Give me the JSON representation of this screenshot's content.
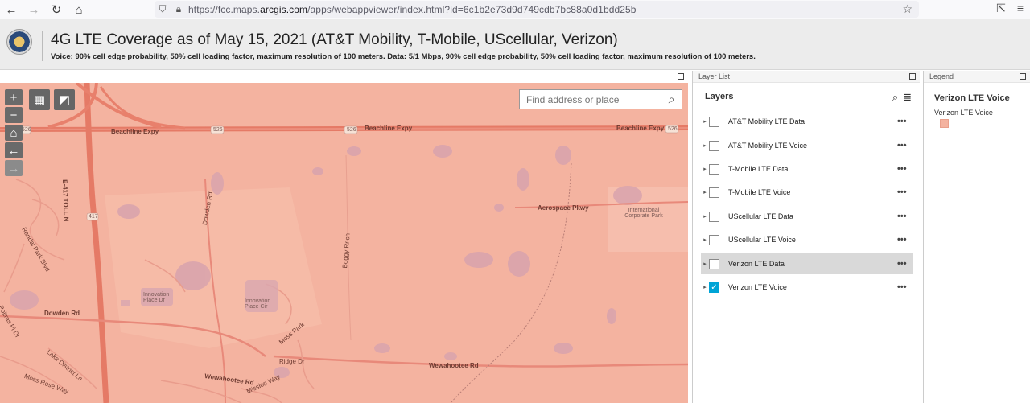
{
  "browser": {
    "back": "←",
    "forward": "→",
    "reload": "↻",
    "home": "⌂",
    "url_prefix": "https://fcc.maps.",
    "url_domain": "arcgis.com",
    "url_suffix": "/apps/webappviewer/index.html?id=6c1b2e73d9d749cdb7bc88a0d1bdd25b",
    "star": "☆"
  },
  "header": {
    "title": "4G LTE Coverage as of May 15, 2021 (AT&T Mobility, T-Mobile, UScellular, Verizon)",
    "subtitle": "Voice: 90% cell edge probability, 50% cell loading factor, maximum resolution of 100 meters.  Data: 5/1 Mbps, 90% cell edge probability, 50% cell loading factor, maximum resolution of 100 meters."
  },
  "map": {
    "search_placeholder": "Find address or place",
    "zoom_in": "+",
    "zoom_out": "−",
    "home": "⌂",
    "back": "←",
    "forward": "→",
    "labels": {
      "beachline1": "Beachline Expy",
      "beachline2": "Beachline Expy",
      "beachline3": "Beachline Expy",
      "shield_526a": "526",
      "shield_526b": "526",
      "shield_526c": "526",
      "shield_526d": "526",
      "shield_417": "417",
      "toll": "E-417 TOLL N",
      "randal": "Randal Park Blvd",
      "dowden_rd": "Dowden Rd",
      "dowden_rd2": "Dowden Rd",
      "aerospace": "Aerospace Pkwy",
      "intl_corp": "International Corporate Park",
      "boggy": "Boggy Rnch",
      "innovation1": "Innovation Place Dr",
      "innovation2": "Innovation Place Cir",
      "wewahootee1": "Wewahootee Rd",
      "wewahootee2": "Wewahootee Rd",
      "lake_district": "Lake District Ln",
      "ridge": "Ridge Dr",
      "moss_park": "Moss Park",
      "moss_rose": "Moss Rose Way",
      "poitras": "Poitras Pl Dr",
      "mission_way": "Mission Way"
    }
  },
  "layer_list": {
    "panel_title": "Layer List",
    "title": "Layers",
    "layers": [
      {
        "label": "AT&T Mobility LTE Data",
        "checked": false
      },
      {
        "label": "AT&T Mobility LTE Voice",
        "checked": false
      },
      {
        "label": "T-Mobile LTE Data",
        "checked": false
      },
      {
        "label": "T-Mobile LTE Voice",
        "checked": false
      },
      {
        "label": "UScellular LTE Data",
        "checked": false
      },
      {
        "label": "UScellular LTE Voice",
        "checked": false
      },
      {
        "label": "Verizon LTE Data",
        "checked": false
      },
      {
        "label": "Verizon LTE Voice",
        "checked": true
      }
    ]
  },
  "legend": {
    "panel_title": "Legend",
    "title": "Verizon LTE Voice",
    "item_label": "Verizon LTE Voice",
    "swatch_color": "#f4b3a0"
  }
}
